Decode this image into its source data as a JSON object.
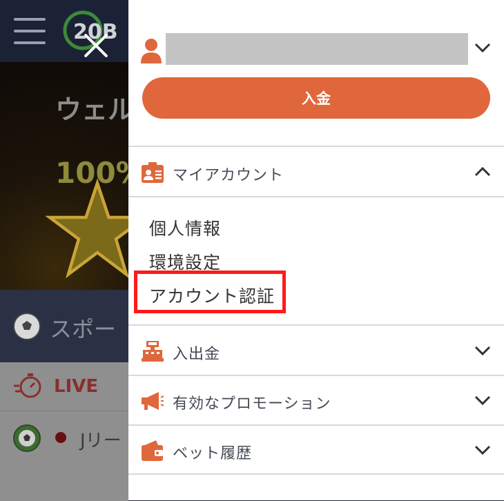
{
  "background": {
    "logo_text": "20B",
    "banner_title": "ウェル",
    "banner_bonus": "100%",
    "sports_label": "スポー",
    "live_label": "LIVE",
    "jleague_label": "Jリー"
  },
  "drawer": {
    "deposit_label": "入金",
    "my_account": {
      "label": "マイアカウント",
      "items": [
        {
          "label": "個人情報"
        },
        {
          "label": "環境設定"
        },
        {
          "label": "アカウント認証"
        }
      ]
    },
    "sections": [
      {
        "label": "入出金",
        "icon": "cash-register-icon"
      },
      {
        "label": "有効なプロモーション",
        "icon": "megaphone-icon"
      },
      {
        "label": "ベット履歴",
        "icon": "wallet-icon"
      }
    ]
  },
  "colors": {
    "accent": "#e0673c",
    "highlight": "#ff1a1a"
  }
}
